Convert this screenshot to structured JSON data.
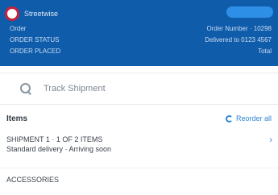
{
  "header": {
    "brand": "Streetwise",
    "status_pill": "",
    "left_lines": [
      "Order",
      "ORDER STATUS",
      "ORDER PLACED"
    ],
    "right_lines": [
      "Order Number · 10298",
      "Delivered to 0123 4567",
      "Total"
    ]
  },
  "search": {
    "placeholder": "Track Shipment"
  },
  "section": {
    "title": "Items",
    "action_label": "Reorder all"
  },
  "items": [
    {
      "title": "SHIPMENT 1 · 1 OF 2 ITEMS",
      "meta": "Standard delivery · Arriving soon",
      "time": "",
      "chevron": "›"
    },
    {
      "title": "ACCESSORIES",
      "meta": "",
      "time": "",
      "chevron": ""
    }
  ]
}
